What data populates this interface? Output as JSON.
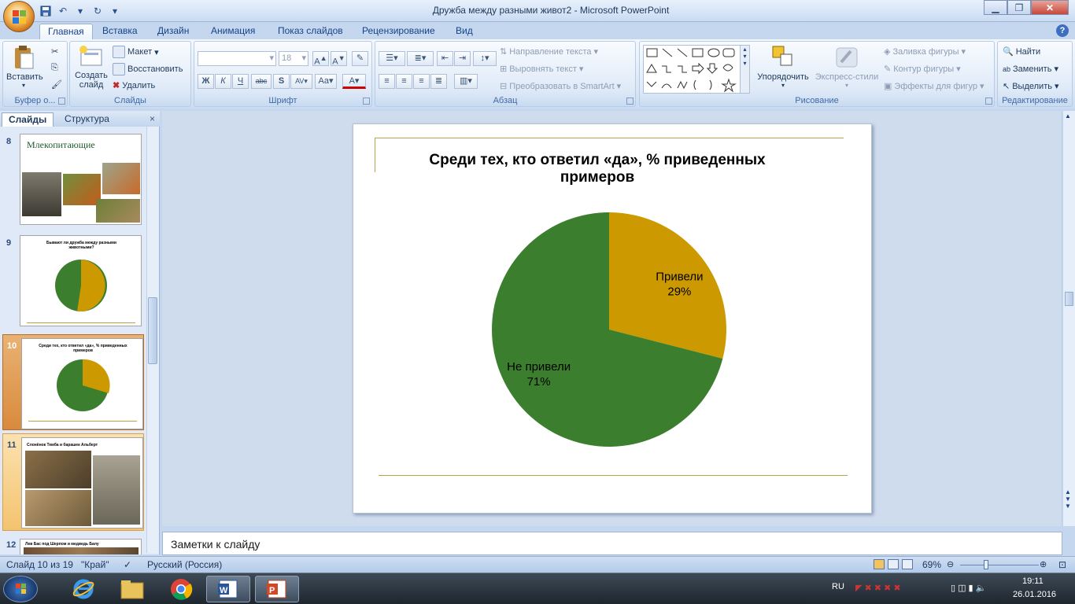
{
  "window": {
    "title": "Дружба между разными живот2 - Microsoft PowerPoint"
  },
  "tabs": [
    "Главная",
    "Вставка",
    "Дизайн",
    "Анимация",
    "Показ слайдов",
    "Рецензирование",
    "Вид"
  ],
  "ribbon": {
    "clipboard": {
      "paste": "Вставить",
      "group": "Буфер о..."
    },
    "slides": {
      "new_slide": "Создать слайд",
      "layout": "Макет",
      "reset": "Восстановить",
      "delete": "Удалить",
      "group": "Слайды"
    },
    "font": {
      "font_size": "18",
      "group": "Шрифт"
    },
    "paragraph": {
      "text_direction": "Направление текста",
      "align_text": "Выровнять текст",
      "smartart": "Преобразовать в SmartArt",
      "group": "Абзац"
    },
    "drawing": {
      "arrange": "Упорядочить",
      "quick_styles": "Экспресс-стили",
      "fill": "Заливка фигуры",
      "outline": "Контур фигуры",
      "effects": "Эффекты для фигур",
      "group": "Рисование"
    },
    "editing": {
      "find": "Найти",
      "replace": "Заменить",
      "select": "Выделить",
      "group": "Редактирование"
    }
  },
  "left_pane": {
    "tab_slides": "Слайды",
    "tab_outline": "Структура",
    "close": "×",
    "thumbs": [
      {
        "num": "8",
        "title": "Млекопитающие"
      },
      {
        "num": "9",
        "title": "Бывают ли дружба между разными животными?"
      },
      {
        "num": "10",
        "title": "Среди тех, кто ответил «да», % приведенных примеров"
      },
      {
        "num": "11",
        "title": "Слонёнок Темба и барашек Альберт"
      },
      {
        "num": "12",
        "title": "Лев Бас под Шерпом и медведь Балу"
      }
    ]
  },
  "slide": {
    "title": "Среди тех, кто ответил «да», % приведенных примеров"
  },
  "chart_data": {
    "type": "pie",
    "title": "Среди тех, кто ответил «да», % приведенных примеров",
    "labels": [
      "Привели",
      "Не привели"
    ],
    "values": [
      29,
      71
    ],
    "value_labels": [
      "29%",
      "71%"
    ],
    "colors": [
      "#CC9A00",
      "#3B7F2E"
    ]
  },
  "notes": {
    "placeholder": "Заметки к слайду"
  },
  "status": {
    "slide_counter": "Слайд 10 из 19",
    "theme": "\"Край\"",
    "language": "Русский (Россия)",
    "zoom": "69%"
  },
  "taskbar": {
    "lang": "RU",
    "time": "19:11",
    "date": "26.01.2016"
  }
}
